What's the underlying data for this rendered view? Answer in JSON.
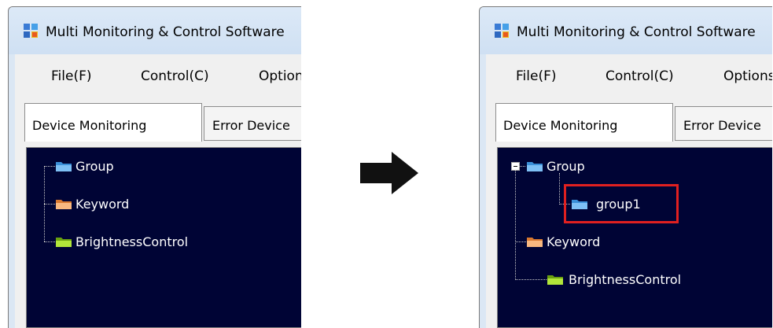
{
  "left_window": {
    "title": "Multi Monitoring & Control Software",
    "menu": [
      "File(F)",
      "Control(C)",
      "Options"
    ],
    "tabs": [
      "Device Monitoring",
      "Error Device"
    ],
    "tree": [
      "Group",
      "Keyword",
      "BrightnessControl"
    ]
  },
  "right_window": {
    "title": "Multi Monitoring & Control Software",
    "menu": [
      "File(F)",
      "Control(C)",
      "Options"
    ],
    "tabs": [
      "Device Monitoring",
      "Error Device"
    ],
    "tree": [
      "Group",
      "group1",
      "Keyword",
      "BrightnessControl"
    ]
  },
  "colors": {
    "tree_background": "#000435",
    "folder_group": "#3a8fd8",
    "folder_keyword": "#f0a060",
    "folder_brightness": "#9ad41c",
    "highlight": "#e02020"
  },
  "icons": [
    "app-icon",
    "folder-icon",
    "arrow-right-icon",
    "collapse-icon"
  ]
}
